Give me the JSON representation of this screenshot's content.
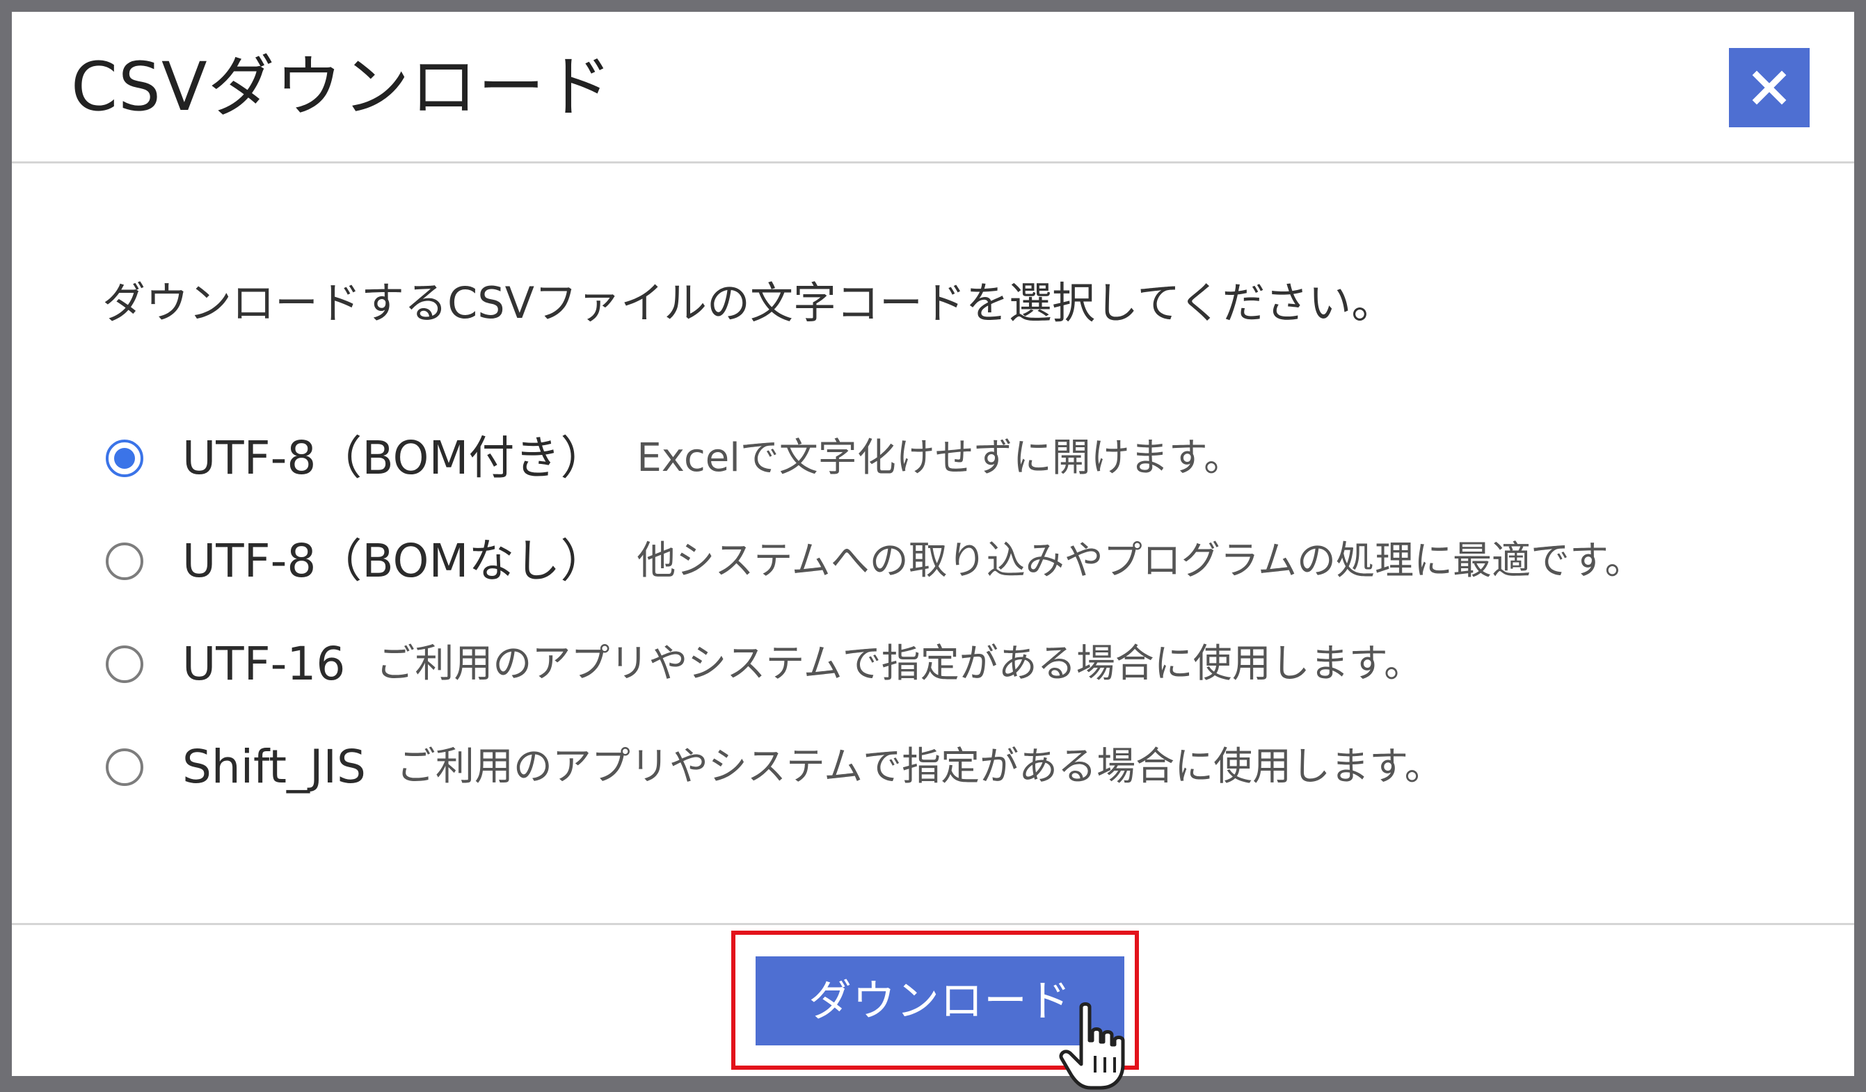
{
  "dialog": {
    "title": "CSVダウンロード",
    "close_icon": "close-icon",
    "instruction": "ダウンロードするCSVファイルの文字コードを選択してください。",
    "options": [
      {
        "label": "UTF-8（BOM付き）",
        "description": "Excelで文字化けせずに開けます。",
        "checked": true
      },
      {
        "label": "UTF-8（BOMなし）",
        "description": "他システムへの取り込みやプログラムの処理に最適です。",
        "checked": false
      },
      {
        "label": "UTF-16",
        "description": "ご利用のアプリやシステムで指定がある場合に使用します。",
        "checked": false
      },
      {
        "label": "Shift_JIS",
        "description": "ご利用のアプリやシステムで指定がある場合に使用します。",
        "checked": false
      }
    ],
    "download_label": "ダウンロード"
  },
  "colors": {
    "accent": "#4e6fd2",
    "radio_checked": "#3b74e8",
    "highlight": "#e3121b",
    "overlay": "#6f6f74"
  },
  "icons": {
    "close": "close-icon",
    "cursor": "hand-pointer-icon"
  }
}
